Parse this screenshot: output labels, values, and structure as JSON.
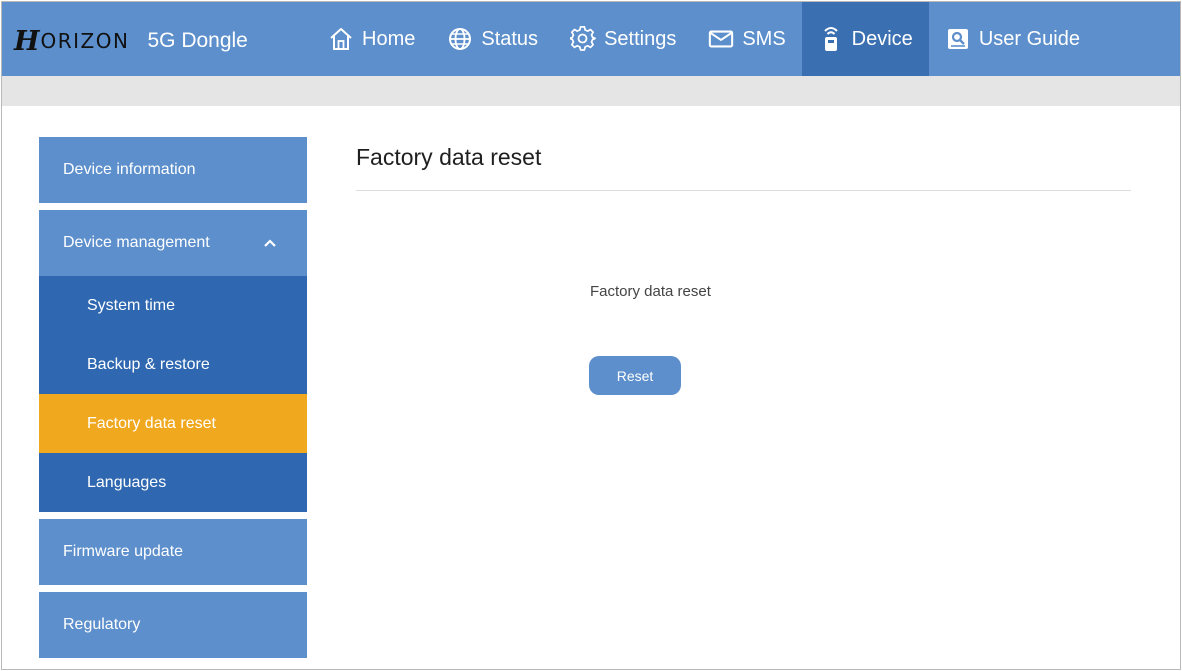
{
  "header": {
    "brand_mark": "H",
    "brand_name": "ORIZON",
    "product": "5G Dongle",
    "nav": [
      {
        "label": "Home",
        "icon": "home-icon"
      },
      {
        "label": "Status",
        "icon": "globe-icon"
      },
      {
        "label": "Settings",
        "icon": "gear-icon"
      },
      {
        "label": "SMS",
        "icon": "envelope-icon"
      },
      {
        "label": "Device",
        "icon": "device-icon",
        "active": true
      },
      {
        "label": "User Guide",
        "icon": "user-guide-icon"
      }
    ]
  },
  "sidebar": {
    "device_information": "Device information",
    "device_management": "Device management",
    "sub_items": [
      "System time",
      "Backup & restore",
      "Factory data reset",
      "Languages"
    ],
    "active_sub_item": "Factory data reset",
    "firmware_update": "Firmware update",
    "regulatory": "Regulatory"
  },
  "main": {
    "title": "Factory data reset",
    "field_label": "Factory data reset",
    "reset_button": "Reset"
  },
  "colors": {
    "primary": "#5c8fcb",
    "primary_dark": "#3a6fb1",
    "submenu": "#2f68b0",
    "active": "#f0a81f"
  }
}
